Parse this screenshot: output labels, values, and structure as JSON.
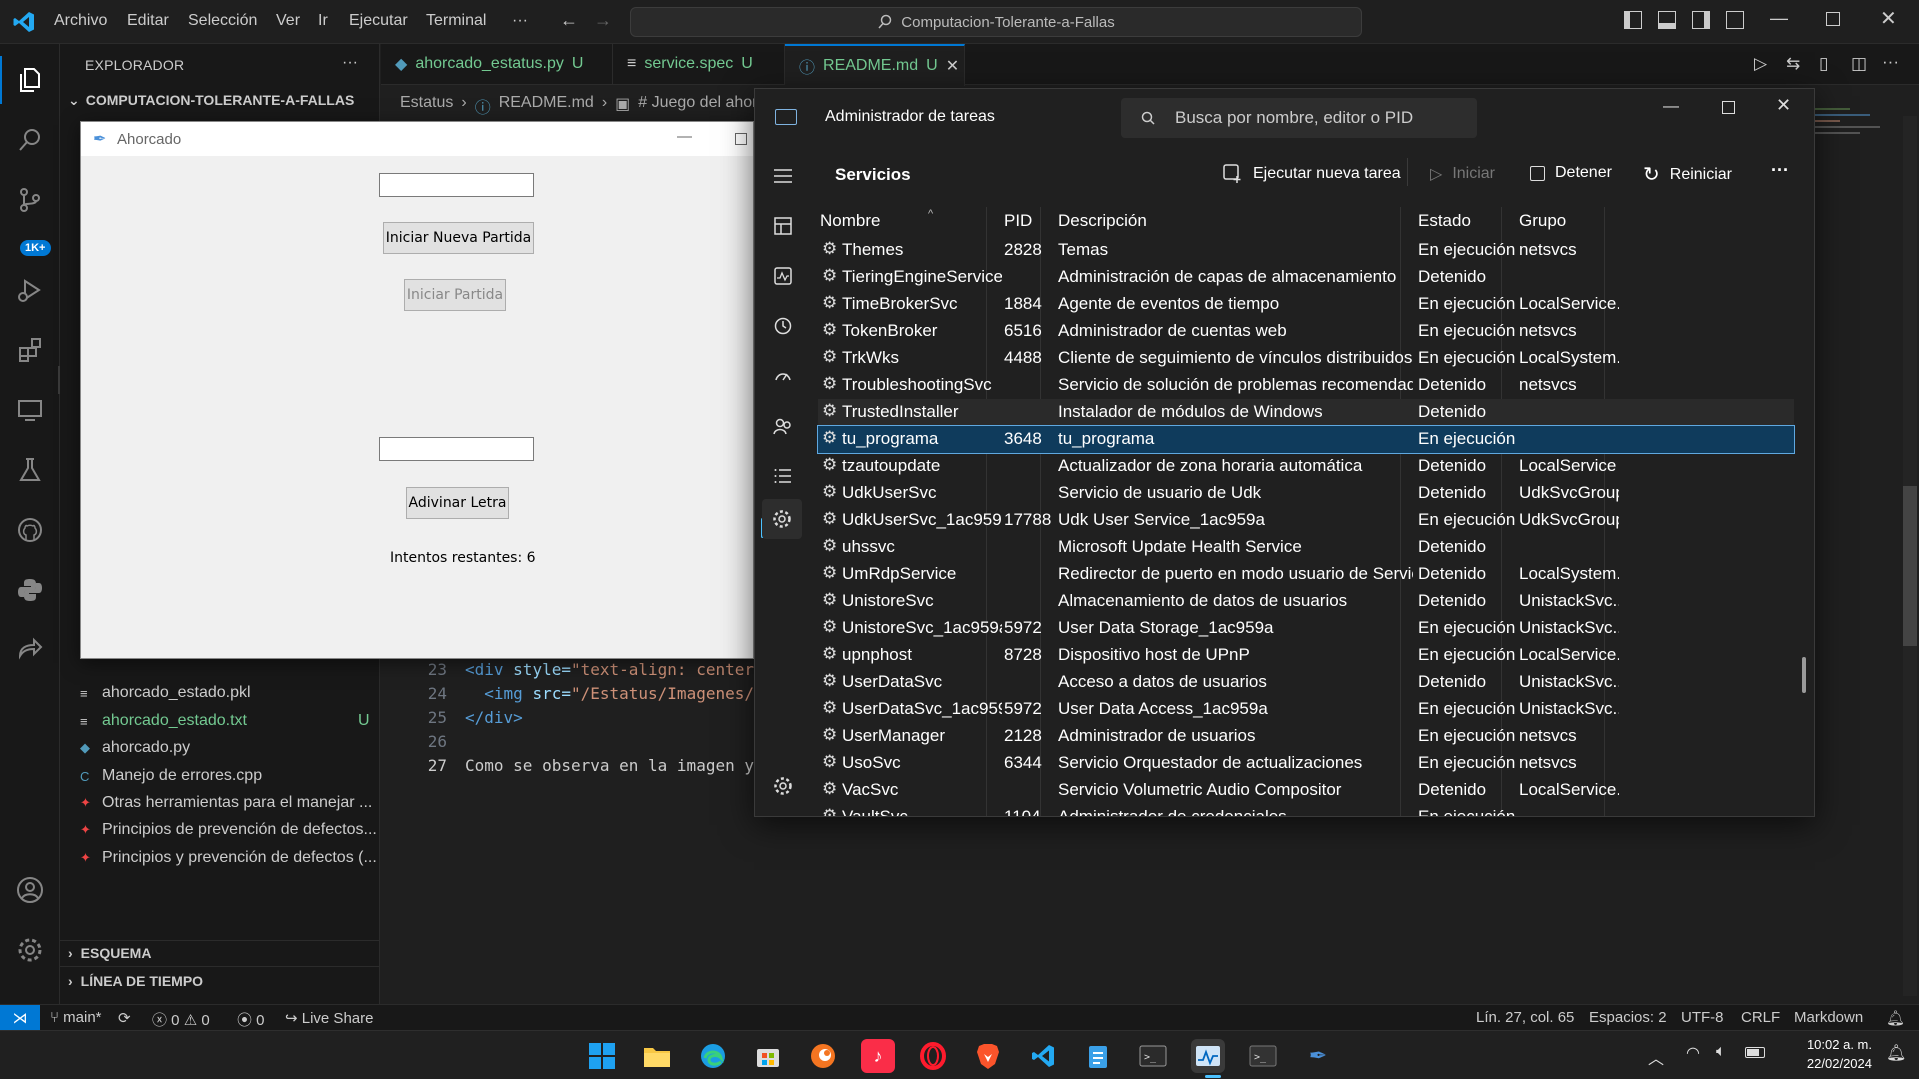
{
  "menu": {
    "items": [
      "Archivo",
      "Editar",
      "Selección",
      "Ver",
      "Ir",
      "Ejecutar",
      "Terminal",
      "···"
    ],
    "search_text": "Computacion-Tolerante-a-Fallas"
  },
  "sidebar": {
    "header": "EXPLORADOR",
    "more": "···",
    "project": "COMPUTACION-TOLERANTE-A-FALLAS",
    "files": [
      {
        "name": "ahorcado_estado.pkl",
        "badge": "",
        "color": "#cccccc",
        "icon": "≡"
      },
      {
        "name": "ahorcado_estado.txt",
        "badge": "U",
        "color": "#73c991",
        "icon": "≡"
      },
      {
        "name": "ahorcado.py",
        "badge": "",
        "color": "#cccccc",
        "icon": "◆"
      },
      {
        "name": "Manejo de errores.cpp",
        "badge": "",
        "color": "#cccccc",
        "icon": "C"
      },
      {
        "name": "Otras herramientas para el manejar ...",
        "badge": "",
        "color": "#cccccc",
        "icon": "✦"
      },
      {
        "name": "Principios de prevención de defectos...",
        "badge": "",
        "color": "#cccccc",
        "icon": "✦"
      },
      {
        "name": "Principios y prevención de defectos (...",
        "badge": "",
        "color": "#cccccc",
        "icon": "✦"
      }
    ],
    "esquema": "ESQUEMA",
    "timeline": "LÍNEA DE TIEMPO"
  },
  "tabs": [
    {
      "label": "ahorcado_estatus.py",
      "badge": "U"
    },
    {
      "label": "service.spec",
      "badge": "U"
    },
    {
      "label": "README.md",
      "badge": "U"
    }
  ],
  "breadcrumb": {
    "p1": "Estatus",
    "p2": "README.md",
    "p3": "# Juego del ahorc"
  },
  "code": {
    "lines": [
      {
        "num": "23",
        "html_a": "<div ",
        "html_b": "style=",
        "html_c": "\"text-align: center"
      },
      {
        "num": "24",
        "html_a": "  <img ",
        "html_b": "src=",
        "html_c": "\"/Estatus/Imagenes/"
      },
      {
        "num": "25",
        "html_a": "</div>",
        "html_b": "",
        "html_c": ""
      },
      {
        "num": "26",
        "html_a": "",
        "html_b": "",
        "html_c": ""
      },
      {
        "num": "27",
        "html_a": "Como se observa en la imagen y",
        "html_b": "",
        "html_c": ""
      }
    ]
  },
  "ahorcado": {
    "title": "Ahorcado",
    "btn_nueva": "Iniciar Nueva Partida",
    "btn_iniciar": "Iniciar Partida",
    "btn_adivinar": "Adivinar Letra",
    "intentos": "Intentos restantes: 6"
  },
  "taskmgr": {
    "title": "Administrador de tareas",
    "search_placeholder": "Busca por nombre, editor o PID",
    "section": "Servicios",
    "toolbar": {
      "new_task": "Ejecutar nueva tarea",
      "start": "Iniciar",
      "stop": "Detener",
      "restart": "Reiniciar",
      "more": "···"
    },
    "columns": {
      "name": "Nombre",
      "pid": "PID",
      "desc": "Descripción",
      "state": "Estado",
      "group": "Grupo"
    },
    "rows": [
      {
        "name": "Themes",
        "pid": "2828",
        "desc": "Temas",
        "state": "En ejecución",
        "group": "netsvcs"
      },
      {
        "name": "TieringEngineService",
        "pid": "",
        "desc": "Administración de capas de almacenamiento",
        "state": "Detenido",
        "group": ""
      },
      {
        "name": "TimeBrokerSvc",
        "pid": "1884",
        "desc": "Agente de eventos de tiempo",
        "state": "En ejecución",
        "group": "LocalService..."
      },
      {
        "name": "TokenBroker",
        "pid": "6516",
        "desc": "Administrador de cuentas web",
        "state": "En ejecución",
        "group": "netsvcs"
      },
      {
        "name": "TrkWks",
        "pid": "4488",
        "desc": "Cliente de seguimiento de vínculos distribuidos",
        "state": "En ejecución",
        "group": "LocalSystem..."
      },
      {
        "name": "TroubleshootingSvc",
        "pid": "",
        "desc": "Servicio de solución de problemas recomendada",
        "state": "Detenido",
        "group": "netsvcs"
      },
      {
        "name": "TrustedInstaller",
        "pid": "",
        "desc": "Instalador de módulos de Windows",
        "state": "Detenido",
        "group": ""
      },
      {
        "name": "tu_programa",
        "pid": "3648",
        "desc": "tu_programa",
        "state": "En ejecución",
        "group": ""
      },
      {
        "name": "tzautoupdate",
        "pid": "",
        "desc": "Actualizador de zona horaria automática",
        "state": "Detenido",
        "group": "LocalService"
      },
      {
        "name": "UdkUserSvc",
        "pid": "",
        "desc": "Servicio de usuario de Udk",
        "state": "Detenido",
        "group": "UdkSvcGroup"
      },
      {
        "name": "UdkUserSvc_1ac959a",
        "pid": "17788",
        "desc": "Udk User Service_1ac959a",
        "state": "En ejecución",
        "group": "UdkSvcGroup"
      },
      {
        "name": "uhssvc",
        "pid": "",
        "desc": "Microsoft Update Health Service",
        "state": "Detenido",
        "group": ""
      },
      {
        "name": "UmRdpService",
        "pid": "",
        "desc": "Redirector de puerto en modo usuario de Servicios de...",
        "state": "Detenido",
        "group": "LocalSystem..."
      },
      {
        "name": "UnistoreSvc",
        "pid": "",
        "desc": "Almacenamiento de datos de usuarios",
        "state": "Detenido",
        "group": "UnistackSvc..."
      },
      {
        "name": "UnistoreSvc_1ac959a",
        "pid": "5972",
        "desc": "User Data Storage_1ac959a",
        "state": "En ejecución",
        "group": "UnistackSvc..."
      },
      {
        "name": "upnphost",
        "pid": "8728",
        "desc": "Dispositivo host de UPnP",
        "state": "En ejecución",
        "group": "LocalService..."
      },
      {
        "name": "UserDataSvc",
        "pid": "",
        "desc": "Acceso a datos de usuarios",
        "state": "Detenido",
        "group": "UnistackSvc..."
      },
      {
        "name": "UserDataSvc_1ac959a",
        "pid": "5972",
        "desc": "User Data Access_1ac959a",
        "state": "En ejecución",
        "group": "UnistackSvc..."
      },
      {
        "name": "UserManager",
        "pid": "2128",
        "desc": "Administrador de usuarios",
        "state": "En ejecución",
        "group": "netsvcs"
      },
      {
        "name": "UsoSvc",
        "pid": "6344",
        "desc": "Servicio Orquestador de actualizaciones",
        "state": "En ejecución",
        "group": "netsvcs"
      },
      {
        "name": "VacSvc",
        "pid": "",
        "desc": "Servicio Volumetric Audio Compositor",
        "state": "Detenido",
        "group": "LocalService..."
      },
      {
        "name": "VaultSvc",
        "pid": "1104",
        "desc": "Administrador de credenciales",
        "state": "En ejecución",
        "group": ""
      }
    ]
  },
  "statusbar": {
    "branch": "main*",
    "errors": "0",
    "warnings": "0",
    "ports": "0",
    "liveshare": "Live Share",
    "position": "Lín. 27, col. 65",
    "spaces": "Espacios: 2",
    "encoding": "UTF-8",
    "eol": "CRLF",
    "language": "Markdown"
  },
  "activity": {
    "badge": "1K+"
  },
  "clock": {
    "time": "10:02 a. m.",
    "date": "22/02/2024"
  },
  "colors": {
    "accent": "#0078d4",
    "selected_row": "#0f3b5c",
    "modified": "#73c991"
  }
}
